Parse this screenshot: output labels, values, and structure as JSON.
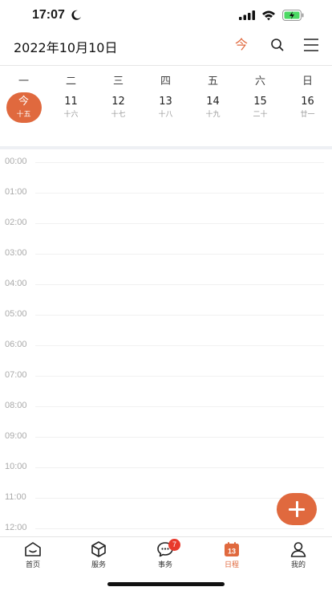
{
  "status_bar": {
    "time": "17:07"
  },
  "header": {
    "date": "2022年10月10日",
    "today_label": "今"
  },
  "week": {
    "weekdays": [
      "一",
      "二",
      "三",
      "四",
      "五",
      "六",
      "日"
    ],
    "days": [
      {
        "num": "今",
        "lunar": "十五",
        "today": true
      },
      {
        "num": "11",
        "lunar": "十六"
      },
      {
        "num": "12",
        "lunar": "十七"
      },
      {
        "num": "13",
        "lunar": "十八"
      },
      {
        "num": "14",
        "lunar": "十九"
      },
      {
        "num": "15",
        "lunar": "二十"
      },
      {
        "num": "16",
        "lunar": "廿一"
      }
    ]
  },
  "timeline": {
    "hours": [
      "00:00",
      "01:00",
      "02:00",
      "03:00",
      "04:00",
      "05:00",
      "06:00",
      "07:00",
      "08:00",
      "09:00",
      "10:00",
      "11:00",
      "12:00"
    ]
  },
  "tabbar": {
    "tabs": [
      {
        "label": "首页",
        "icon": "home-icon"
      },
      {
        "label": "服务",
        "icon": "box-icon"
      },
      {
        "label": "事务",
        "icon": "chat-icon",
        "badge": "7"
      },
      {
        "label": "日程",
        "icon": "calendar-icon",
        "calendar_day": "13",
        "active": true
      },
      {
        "label": "我的",
        "icon": "person-icon"
      }
    ]
  },
  "colors": {
    "accent": "#e0693e",
    "badge": "#e8392c"
  }
}
